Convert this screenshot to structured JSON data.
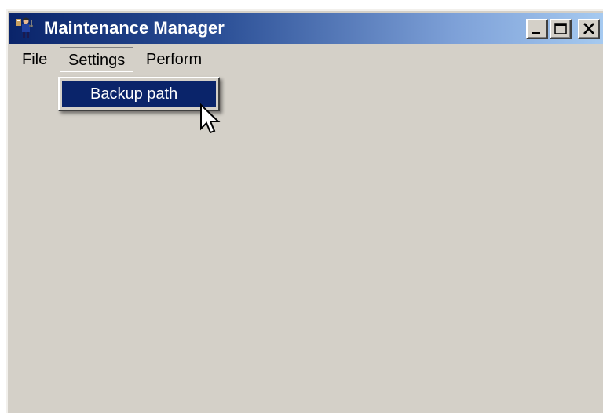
{
  "window": {
    "title": "Maintenance Manager",
    "icon": "maintenance-worker-icon",
    "controls": {
      "minimize_icon": "minimize-icon",
      "maximize_icon": "maximize-icon",
      "close_icon": "close-icon"
    }
  },
  "menubar": {
    "items": [
      {
        "label": "File"
      },
      {
        "label": "Settings",
        "state": "open"
      },
      {
        "label": "Perform"
      }
    ]
  },
  "settings_menu": {
    "items": [
      {
        "label": "Backup path",
        "state": "highlighted"
      }
    ]
  },
  "colors": {
    "titlebar_start": "#0a246a",
    "titlebar_end": "#a6caf0",
    "window_face": "#d4d0c8",
    "highlight": "#0a246a"
  }
}
